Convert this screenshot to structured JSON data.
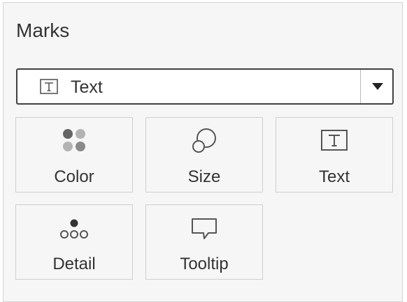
{
  "marks": {
    "title": "Marks",
    "mark_type": {
      "selected": "Text",
      "icon": "text-box-icon"
    },
    "buttons": [
      {
        "label": "Color",
        "icon": "color-dots-icon"
      },
      {
        "label": "Size",
        "icon": "size-circles-icon"
      },
      {
        "label": "Text",
        "icon": "text-box-icon"
      },
      {
        "label": "Detail",
        "icon": "detail-dots-icon"
      },
      {
        "label": "Tooltip",
        "icon": "tooltip-bubble-icon"
      }
    ]
  },
  "colors": {
    "panel_background": "#f6f6f6",
    "text": "#333333",
    "icon_dark": "#666666",
    "icon_light": "#b3b3b3"
  }
}
